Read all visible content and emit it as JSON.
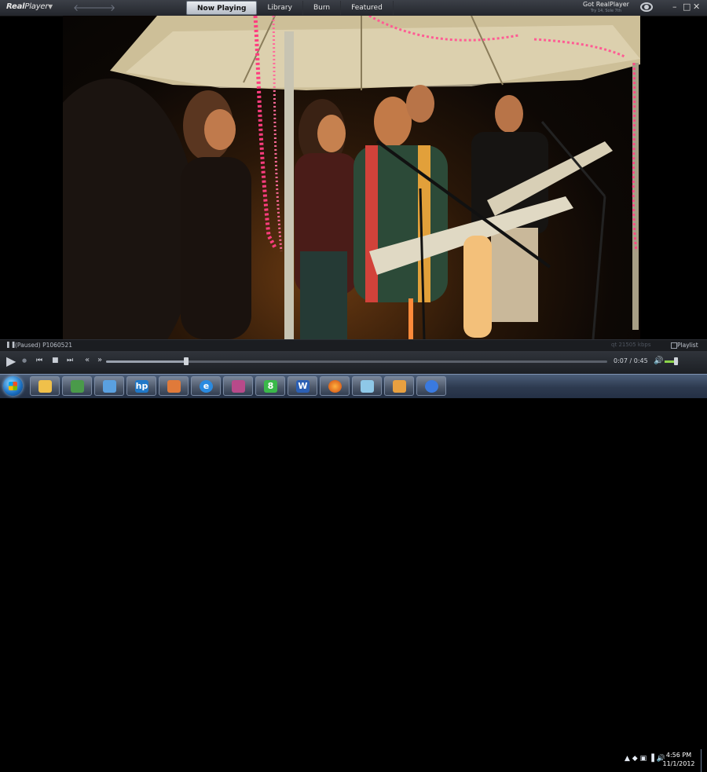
{
  "app": {
    "logo_main": "Real",
    "logo_sub": "Player",
    "tabs": [
      "Now Playing",
      "Library",
      "Burn",
      "Featured"
    ],
    "active_tab": "Now Playing",
    "got_real_title": "Got RealPlayer",
    "got_real_sub": "Try 14, Sole 7th",
    "window_buttons": {
      "minimize": "–",
      "maximize": "□",
      "close": "✕"
    }
  },
  "status": {
    "state": "(Paused)",
    "filename": "P1060521",
    "format": "qt",
    "bitrate": "21505 kbps",
    "playlist_label": "Playlist"
  },
  "playback": {
    "current_time": "0:07",
    "duration": "0:45",
    "time_display": "0:07 / 0:45",
    "progress_fraction": 0.16,
    "volume_fraction": 0.75
  },
  "taskbar": {
    "clock_time": "4:56 PM",
    "clock_date": "11/1/2012",
    "icons": [
      "folder-icon",
      "display-icon",
      "network-icon",
      "hp-icon",
      "cooking-icon",
      "internet-explorer-icon",
      "winrar-icon",
      "numbers-icon",
      "word-icon",
      "firefox-icon",
      "documents-icon",
      "paint-icon",
      "realplayer-icon"
    ],
    "eight_label": "8",
    "hp_label": "hp",
    "w_label": "W"
  },
  "colors": {
    "accent_green": "#8bd34a",
    "tent_canopy": "#d8cfb2",
    "led_pink": "#ff3d7f"
  }
}
